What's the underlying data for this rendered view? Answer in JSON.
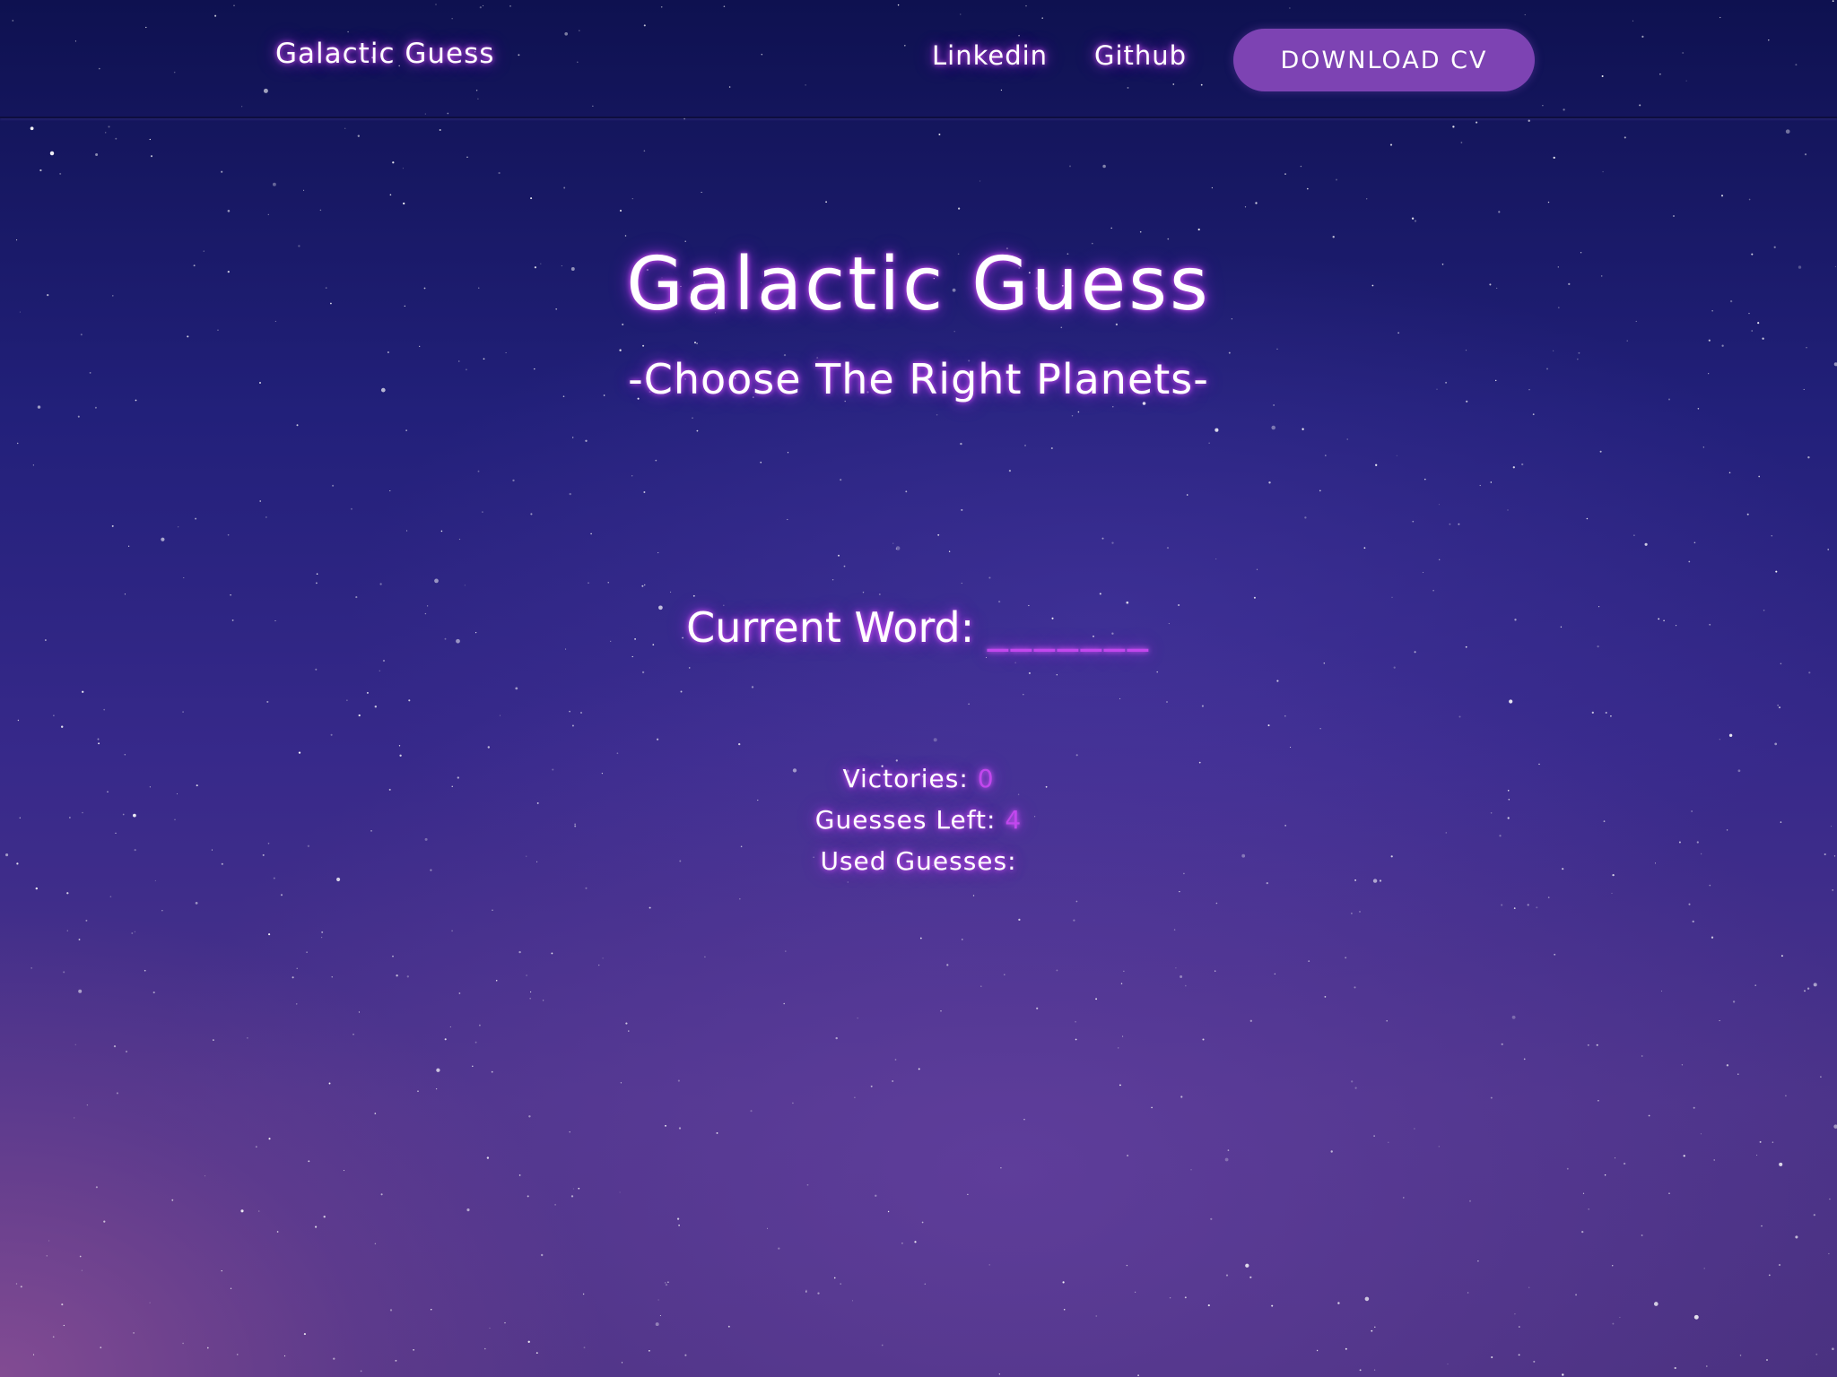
{
  "nav": {
    "brand": "Galactic Guess",
    "links": [
      "Linkedin",
      "Github"
    ],
    "cv_button": "DOWNLOAD CV"
  },
  "hero": {
    "title": "Galactic Guess",
    "subtitle": "-Choose The Right Planets-"
  },
  "game": {
    "current_word_label": "Current Word:",
    "current_word_value": "_______",
    "victories_label": "Victories:",
    "victories_value": "0",
    "guesses_left_label": "Guesses Left:",
    "guesses_left_value": "4",
    "used_guesses_label": "Used Guesses:",
    "used_guesses_value": ""
  },
  "colors": {
    "accent": "#c247ee",
    "button": "#7d43b3",
    "sky_top": "#0e1150",
    "sky_bottom": "#4b3389"
  }
}
